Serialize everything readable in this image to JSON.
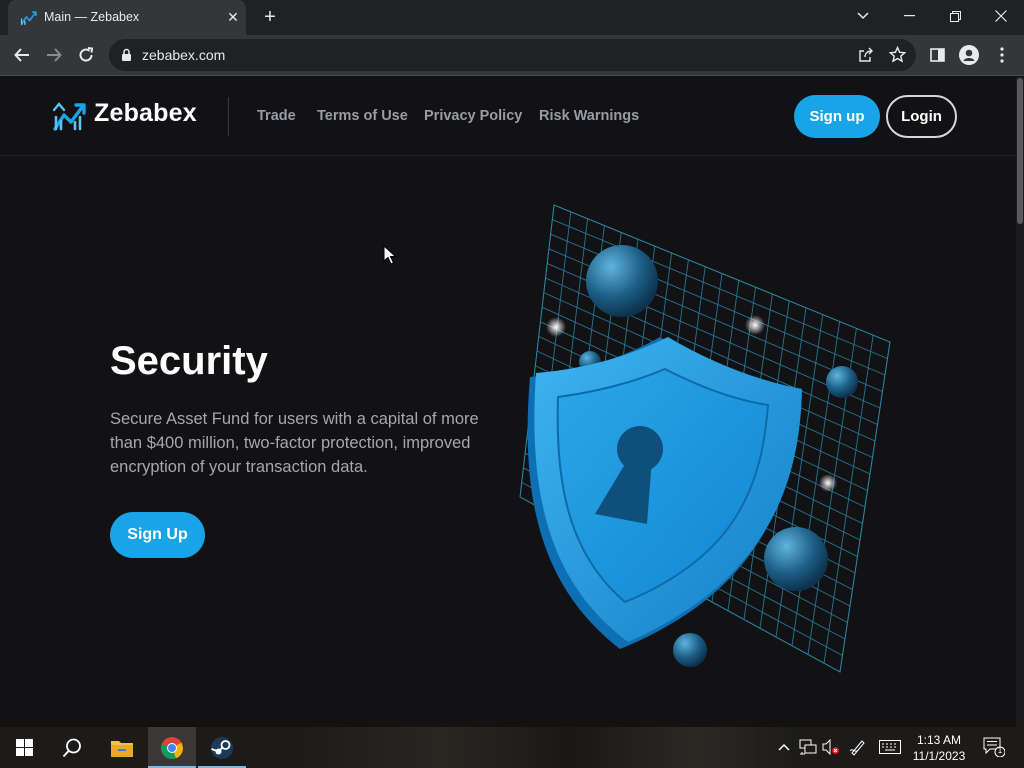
{
  "browser": {
    "tab_title": "Main — Zebabex",
    "tab_close": "✕",
    "new_tab": "+",
    "url": "zebabex.com"
  },
  "site": {
    "logo_text": "Zebabex",
    "nav": [
      {
        "label": "Trade"
      },
      {
        "label": "Terms of Use"
      },
      {
        "label": "Privacy Policy"
      },
      {
        "label": "Risk Warnings"
      }
    ],
    "signup_label": "Sign up",
    "login_label": "Login"
  },
  "hero": {
    "title": "Security",
    "description": "Secure Asset Fund for users with a capital of more than $400 million, two-factor protection, improved encryption of your transaction data.",
    "button_label": "Sign Up"
  },
  "taskbar": {
    "time": "1:13 AM",
    "date": "11/1/2023",
    "notification_count": "1"
  },
  "colors": {
    "accent": "#1aa4e8",
    "page_bg": "#121215",
    "nav_text": "#9a9ca3"
  }
}
